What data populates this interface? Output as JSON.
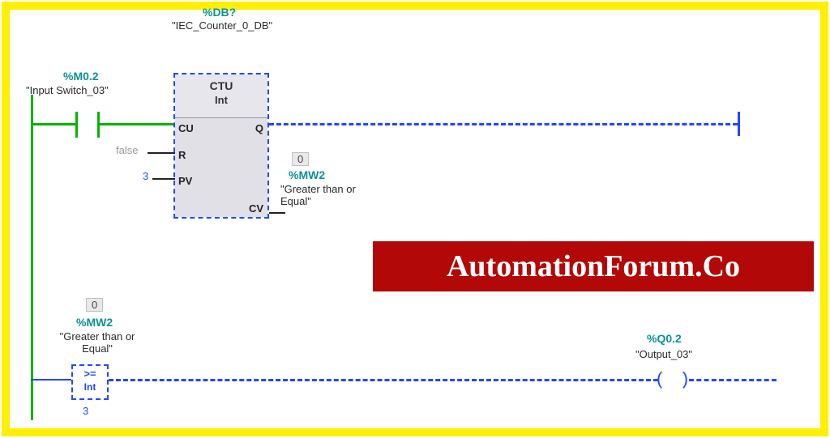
{
  "block": {
    "top_address_partial": "%DB?",
    "name": "\"IEC_Counter_0_DB\"",
    "type": "CTU",
    "datatype": "Int",
    "pins": {
      "cu": "CU",
      "r": "R",
      "pv": "PV",
      "q": "Q",
      "cv": "CV"
    }
  },
  "rung1": {
    "contact": {
      "address": "%M0.2",
      "name": "\"Input Switch_03\""
    },
    "r_input": "false",
    "pv_input": "3",
    "cv_output": {
      "value": "0",
      "address": "%MW2",
      "name": "\"Greater than or Equal\""
    }
  },
  "rung2": {
    "compare": {
      "input": {
        "value": "0",
        "address": "%MW2",
        "name": "\"Greater than or Equal\""
      },
      "operator": ">=",
      "datatype": "Int",
      "operand": "3"
    },
    "coil": {
      "address": "%Q0.2",
      "name": "\"Output_03\""
    }
  },
  "watermark": "AutomationForum.Co"
}
